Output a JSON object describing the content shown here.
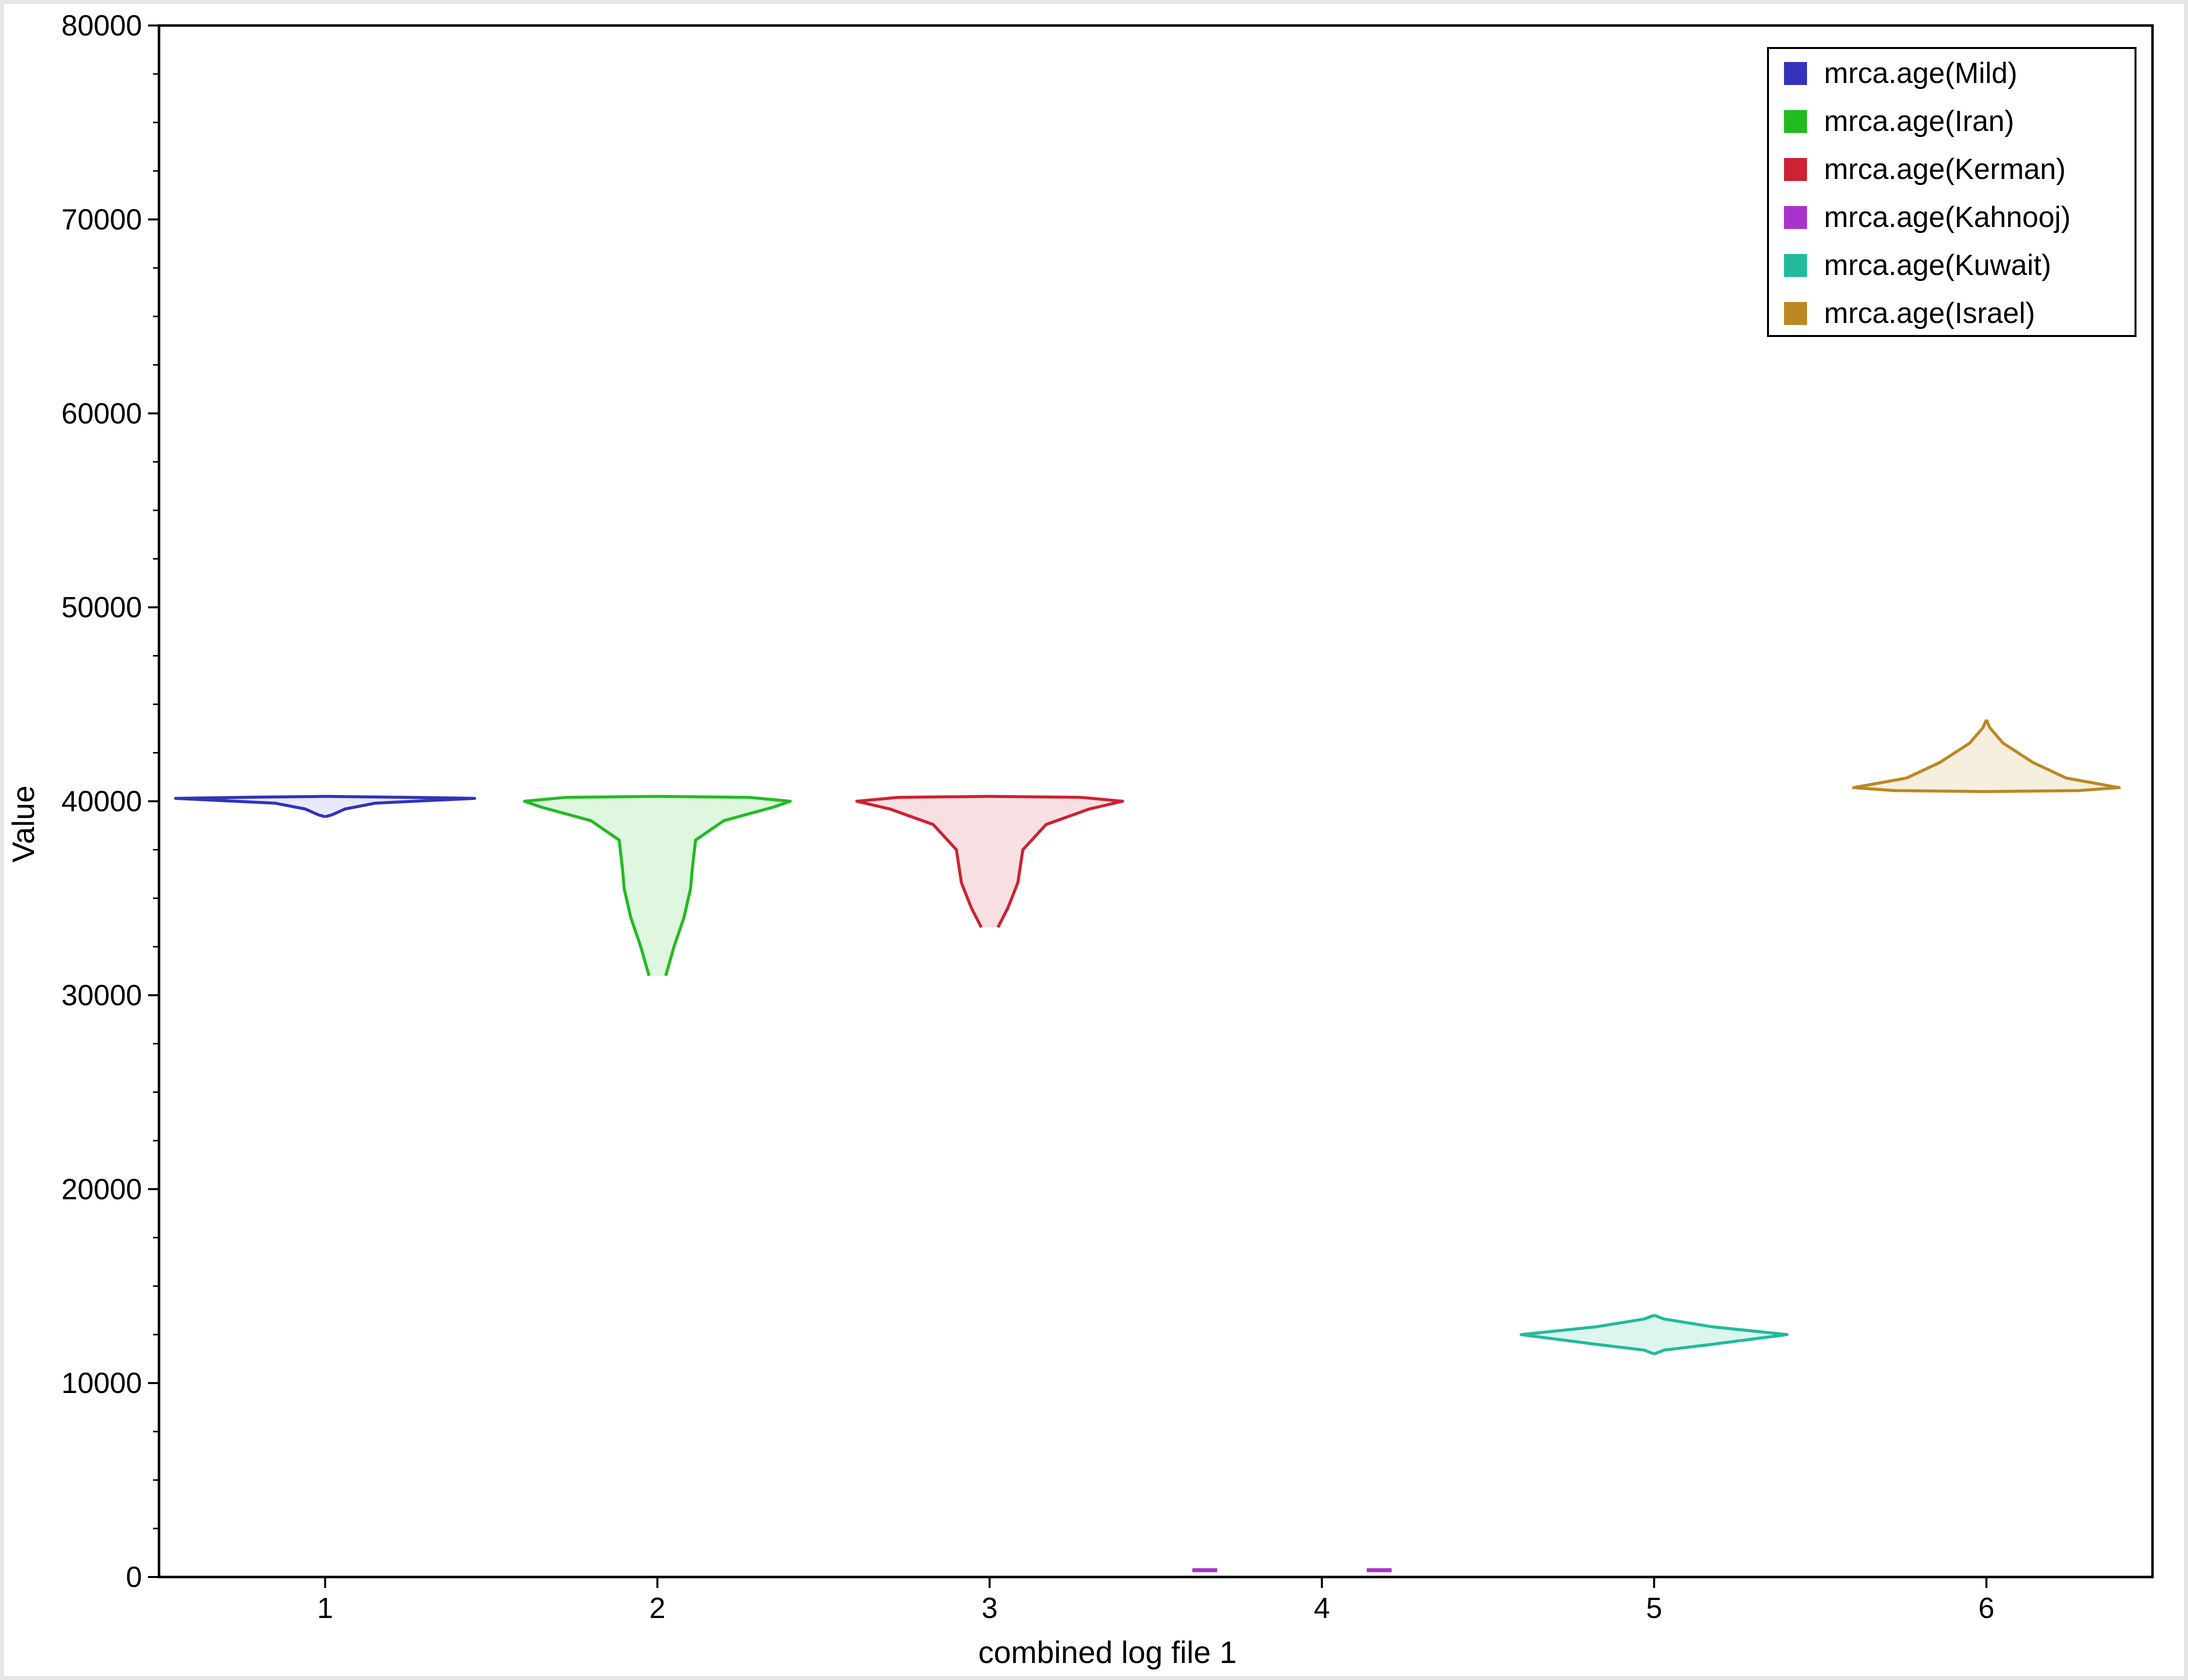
{
  "chart_data": {
    "type": "violin",
    "title": "",
    "xlabel": "combined log file 1",
    "ylabel": "Value",
    "ylim": [
      0,
      80000
    ],
    "y_ticks": [
      "0",
      "10000",
      "20000",
      "30000",
      "40000",
      "50000",
      "60000",
      "70000",
      "80000"
    ],
    "y_tick_values": [
      0,
      10000,
      20000,
      30000,
      40000,
      50000,
      60000,
      70000,
      80000
    ],
    "x_ticks": [
      "1",
      "2",
      "3",
      "4",
      "5",
      "6"
    ],
    "grid": false,
    "legend_position": "top-right",
    "series": [
      {
        "name": "mrca.age(Mild)",
        "x": 1,
        "color": "#3333bb",
        "fill": "#e8e8fa",
        "profile": [
          [
            39200,
            0.0
          ],
          [
            39300,
            0.04
          ],
          [
            39600,
            0.12
          ],
          [
            39900,
            0.3
          ],
          [
            40100,
            0.78
          ],
          [
            40150,
            0.9
          ],
          [
            40200,
            0.5
          ],
          [
            40250,
            0.0
          ]
        ]
      },
      {
        "name": "mrca.age(Iran)",
        "x": 2,
        "color": "#22bb22",
        "fill": "#dff6df",
        "profile": [
          [
            31000,
            0.05
          ],
          [
            32500,
            0.1
          ],
          [
            34000,
            0.16
          ],
          [
            35500,
            0.2
          ],
          [
            36500,
            0.21
          ],
          [
            38000,
            0.23
          ],
          [
            39000,
            0.4
          ],
          [
            39700,
            0.7
          ],
          [
            40000,
            0.8
          ],
          [
            40200,
            0.55
          ],
          [
            40250,
            0.0
          ]
        ]
      },
      {
        "name": "mrca.age(Kerman)",
        "x": 3,
        "color": "#cc2233",
        "fill": "#f8e0e2",
        "profile": [
          [
            33500,
            0.05
          ],
          [
            34500,
            0.11
          ],
          [
            35800,
            0.17
          ],
          [
            37500,
            0.2
          ],
          [
            38800,
            0.34
          ],
          [
            39600,
            0.6
          ],
          [
            40000,
            0.8
          ],
          [
            40200,
            0.55
          ],
          [
            40250,
            0.0
          ]
        ]
      },
      {
        "name": "mrca.age(Kahnooj)",
        "x": 4,
        "color": "#aa33cc",
        "fill": "#f3e0f8",
        "segments": [
          [
            -0.78,
            -0.63
          ],
          [
            0.27,
            0.42
          ]
        ],
        "value": 350
      },
      {
        "name": "mrca.age(Kuwait)",
        "x": 5,
        "color": "#22bb99",
        "fill": "#ddf5ef",
        "profile": [
          [
            11500,
            0.0
          ],
          [
            11700,
            0.06
          ],
          [
            12000,
            0.35
          ],
          [
            12500,
            0.8
          ],
          [
            12900,
            0.35
          ],
          [
            13300,
            0.06
          ],
          [
            13500,
            0.0
          ]
        ]
      },
      {
        "name": "mrca.age(Israel)",
        "x": 6,
        "color": "#bb8822",
        "fill": "#f6efdf",
        "profile": [
          [
            40500,
            0.0
          ],
          [
            40550,
            0.55
          ],
          [
            40700,
            0.8
          ],
          [
            41200,
            0.48
          ],
          [
            42000,
            0.28
          ],
          [
            43000,
            0.1
          ],
          [
            43800,
            0.02
          ],
          [
            44200,
            0.0
          ]
        ]
      }
    ]
  }
}
